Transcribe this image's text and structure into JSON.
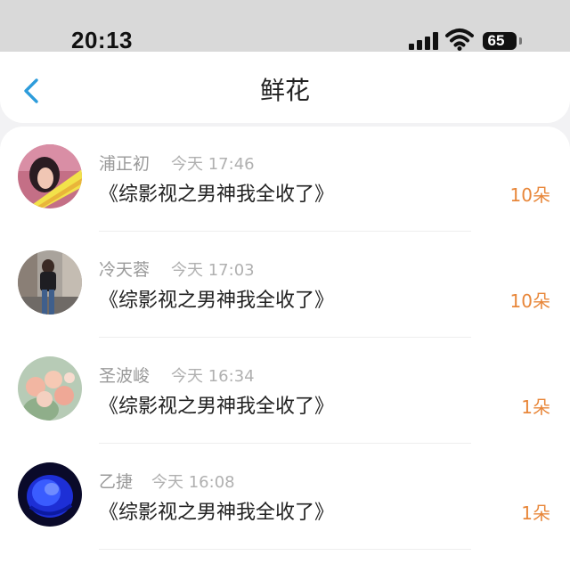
{
  "status_bar": {
    "time": "20:13",
    "battery": "65"
  },
  "nav": {
    "title": "鲜花",
    "back_icon": "chevron-left-icon"
  },
  "colors": {
    "accent": "#2d9cdb",
    "count": "#e8873a",
    "name": "#9a9a9a",
    "time": "#b0b0b0"
  },
  "items": [
    {
      "name": "浦正初",
      "time": "今天 17:46",
      "book": "《综影视之男神我全收了》",
      "count": "10朵"
    },
    {
      "name": "冷天蓉",
      "time": "今天 17:03",
      "book": "《综影视之男神我全收了》",
      "count": "10朵"
    },
    {
      "name": "圣波峻",
      "time": "今天 16:34",
      "book": "《综影视之男神我全收了》",
      "count": "1朵"
    },
    {
      "name": "乙捷",
      "time": "今天 16:08",
      "book": "《综影视之男神我全收了》",
      "count": "1朵"
    }
  ]
}
